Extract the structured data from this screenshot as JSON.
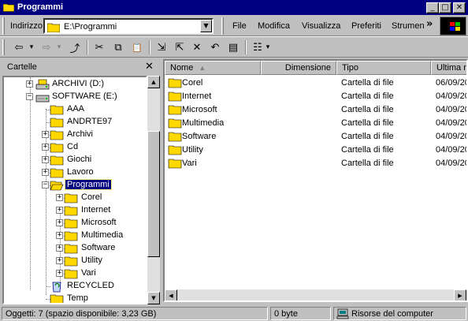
{
  "window": {
    "title": "Programmi"
  },
  "titlebar_buttons": {
    "minimize": "_",
    "maximize": "□",
    "close": "✕"
  },
  "address": {
    "label": "Indirizzo",
    "value": "E:\\Programmi"
  },
  "menu": {
    "items": [
      "File",
      "Modifica",
      "Visualizza",
      "Preferiti",
      "Strumen"
    ],
    "more": "»"
  },
  "toolbar": {
    "buttons": [
      {
        "name": "back-icon",
        "glyph": "⇦"
      },
      {
        "name": "back-dropdown-icon",
        "glyph": "▾"
      },
      {
        "name": "forward-icon",
        "glyph": "⇨"
      },
      {
        "name": "forward-dropdown-icon",
        "glyph": "▾"
      },
      {
        "name": "up-folder-icon",
        "glyph": "⤴"
      },
      {
        "name": "cut-icon",
        "glyph": "✂"
      },
      {
        "name": "copy-icon",
        "glyph": "⧉"
      },
      {
        "name": "paste-icon",
        "glyph": "📋"
      },
      {
        "name": "move-to-icon",
        "glyph": "⇲"
      },
      {
        "name": "copy-to-icon",
        "glyph": "⇱"
      },
      {
        "name": "delete-icon",
        "glyph": "✕"
      },
      {
        "name": "undo-icon",
        "glyph": "↶"
      },
      {
        "name": "properties-icon",
        "glyph": "▤"
      },
      {
        "name": "views-icon",
        "glyph": "☷"
      },
      {
        "name": "views-dropdown-icon",
        "glyph": "▾"
      }
    ]
  },
  "folders_pane": {
    "title": "Cartelle",
    "close": "✕",
    "tree": [
      {
        "label": "ARCHIVI (D:)",
        "type": "drive",
        "expander": "+"
      },
      {
        "label": "SOFTWARE (E:)",
        "type": "drive",
        "expander": "−"
      },
      {
        "label": "AAA",
        "type": "folder",
        "expander": ""
      },
      {
        "label": "ANDRTE97",
        "type": "folder",
        "expander": ""
      },
      {
        "label": "Archivi",
        "type": "folder",
        "expander": "+"
      },
      {
        "label": "Cd",
        "type": "folder",
        "expander": "+"
      },
      {
        "label": "Giochi",
        "type": "folder",
        "expander": "+"
      },
      {
        "label": "Lavoro",
        "type": "folder",
        "expander": "+"
      },
      {
        "label": "Programmi",
        "type": "open-folder",
        "expander": "−",
        "selected": true
      },
      {
        "label": "Corel",
        "type": "folder",
        "expander": "+"
      },
      {
        "label": "Internet",
        "type": "folder",
        "expander": "+"
      },
      {
        "label": "Microsoft",
        "type": "folder",
        "expander": "+"
      },
      {
        "label": "Multimedia",
        "type": "folder",
        "expander": "+"
      },
      {
        "label": "Software",
        "type": "folder",
        "expander": "+"
      },
      {
        "label": "Utility",
        "type": "folder",
        "expander": "+"
      },
      {
        "label": "Vari",
        "type": "folder",
        "expander": "+"
      },
      {
        "label": "RECYCLED",
        "type": "recycle",
        "expander": ""
      },
      {
        "label": "Temp",
        "type": "folder",
        "expander": ""
      }
    ]
  },
  "file_list": {
    "columns": [
      "Nome",
      "Dimensione",
      "Tipo",
      "Ultima m"
    ],
    "sort_indicator": "▲",
    "rows": [
      {
        "name": "Corel",
        "type": "Cartella di file",
        "date": "06/09/20"
      },
      {
        "name": "Internet",
        "type": "Cartella di file",
        "date": "04/09/20"
      },
      {
        "name": "Microsoft",
        "type": "Cartella di file",
        "date": "04/09/20"
      },
      {
        "name": "Multimedia",
        "type": "Cartella di file",
        "date": "04/09/20"
      },
      {
        "name": "Software",
        "type": "Cartella di file",
        "date": "04/09/20"
      },
      {
        "name": "Utility",
        "type": "Cartella di file",
        "date": "04/09/20"
      },
      {
        "name": "Vari",
        "type": "Cartella di file",
        "date": "04/09/20"
      }
    ]
  },
  "statusbar": {
    "objects": "Oggetti: 7 (spazio disponibile: 3,23 GB)",
    "size": "0 byte",
    "location": "Risorse del computer"
  },
  "colors": {
    "title_bar": "#000080",
    "face": "#c0c0c0",
    "folder": "#ffd800",
    "selection": "#000080"
  }
}
